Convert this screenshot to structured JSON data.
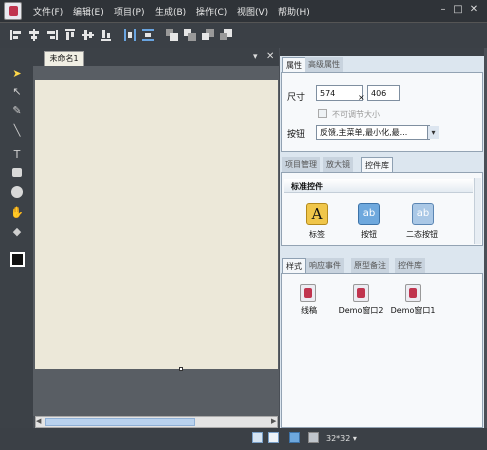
{
  "menu": [
    "文件(F)",
    "编辑(E)",
    "项目(P)",
    "生成(B)",
    "操作(C)",
    "视图(V)",
    "帮助(H)"
  ],
  "window_controls": [
    "–",
    "□",
    "✕"
  ],
  "document_tab": "未命名1",
  "properties": {
    "tabs": [
      "属性",
      "高级属性"
    ],
    "size_label": "尺寸",
    "width": "574",
    "times": "×",
    "height": "406",
    "fixed_size_label": "不可调节大小",
    "buttons_label": "按钮",
    "buttons_value": "反馈,主菜单,最小化,最..."
  },
  "library": {
    "tabs": [
      "项目管理",
      "放大镜",
      "控件库"
    ],
    "section": "标准控件",
    "controls": [
      {
        "label": "标签",
        "icon": "label-control-icon"
      },
      {
        "label": "按钮",
        "icon": "button-control-icon"
      },
      {
        "label": "二态按钮",
        "icon": "toggle-button-control-icon"
      }
    ]
  },
  "resources": {
    "tabs": [
      "样式",
      "响应事件",
      "原型备注",
      "控件库"
    ],
    "items": [
      "线稿",
      "Demo窗口2",
      "Demo窗口1"
    ]
  },
  "status": {
    "zoom": "32*32 ▾"
  },
  "colors": {
    "accent": "#69a4e0",
    "brand": "#c0344e",
    "panel": "#dce6ef"
  }
}
